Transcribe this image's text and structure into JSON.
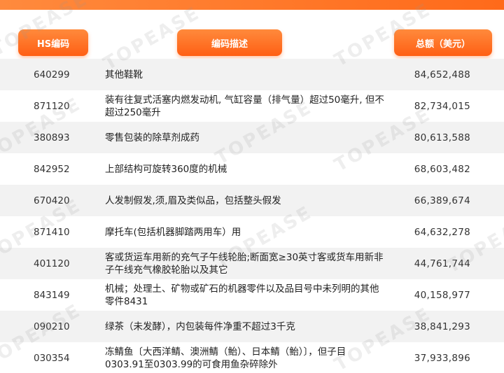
{
  "header": {
    "hs_code_label": "HS编码",
    "description_label": "编码描述",
    "total_label": "总额（美元）"
  },
  "watermark_text": "TOPEASE",
  "rows": [
    {
      "code": "640299",
      "description": "其他鞋靴",
      "total": "84,652,488"
    },
    {
      "code": "871120",
      "description": "装有往复式活塞内燃发动机, 气缸容量（排气量）超过50毫升, 但不超过250毫升",
      "total": "82,734,015"
    },
    {
      "code": "380893",
      "description": "零售包装的除草剂成药",
      "total": "80,613,588"
    },
    {
      "code": "842952",
      "description": "上部结构可旋转360度的机械",
      "total": "68,603,482"
    },
    {
      "code": "670420",
      "description": "人发制假发,须,眉及类似品，包括整头假发",
      "total": "66,389,674"
    },
    {
      "code": "871410",
      "description": "摩托车(包括机器脚踏两用车）用",
      "total": "64,632,278"
    },
    {
      "code": "401120",
      "description": "客或货运车用新的充气子午线轮胎;断面宽≥30英寸客或货车用新非子午线充气橡胶轮胎以及其它",
      "total": "44,761,744"
    },
    {
      "code": "843149",
      "description": "机械；处理土、矿物或矿石的机器零件以及品目号中未列明的其他零件8431",
      "total": "40,158,977"
    },
    {
      "code": "090210",
      "description": "绿茶（未发酵），内包装每件净重不超过3千克",
      "total": "38,841,293"
    },
    {
      "code": "030354",
      "description": "冻鲭鱼〔大西洋鲭、澳洲鲭（鲐）、日本鲭（鲐）〕，但子目0303.91至0303.99的可食用鱼杂碎除外",
      "total": "37,933,896"
    }
  ]
}
